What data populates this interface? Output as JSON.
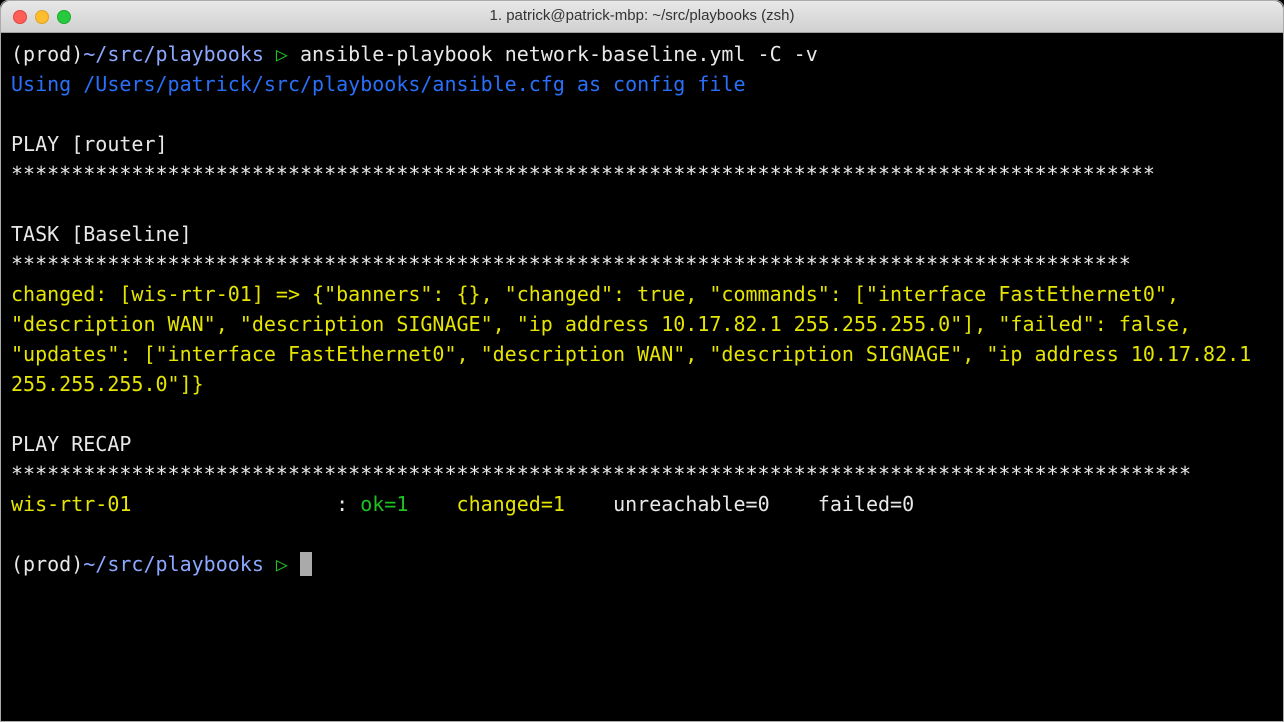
{
  "window": {
    "title": "1. patrick@patrick-mbp: ~/src/playbooks (zsh)"
  },
  "prompt1": {
    "env": "(prod)",
    "path": "~/src/playbooks",
    "symbol": " ▷ ",
    "command": "ansible-playbook network-baseline.yml -C -v"
  },
  "cfg_line": "Using /Users/patrick/src/playbooks/ansible.cfg as config file",
  "play_header": "PLAY [router] ***********************************************************************************************",
  "task_header": "TASK [Baseline] *********************************************************************************************",
  "task_output": "changed: [wis-rtr-01] => {\"banners\": {}, \"changed\": true, \"commands\": [\"interface FastEthernet0\", \"description WAN\", \"description SIGNAGE\", \"ip address 10.17.82.1 255.255.255.0\"], \"failed\": false, \"updates\": [\"interface FastEthernet0\", \"description WAN\", \"description SIGNAGE\", \"ip address 10.17.82.1 255.255.255.0\"]}",
  "recap_header": "PLAY RECAP **************************************************************************************************",
  "recap": {
    "host": "wis-rtr-01                 ",
    "colon": ": ",
    "ok": "ok=1   ",
    "changed": " changed=1   ",
    "unreachable": " unreachable=0   ",
    "failed": " failed=0"
  },
  "prompt2": {
    "env": "(prod)",
    "path": "~/src/playbooks",
    "symbol": " ▷ "
  }
}
